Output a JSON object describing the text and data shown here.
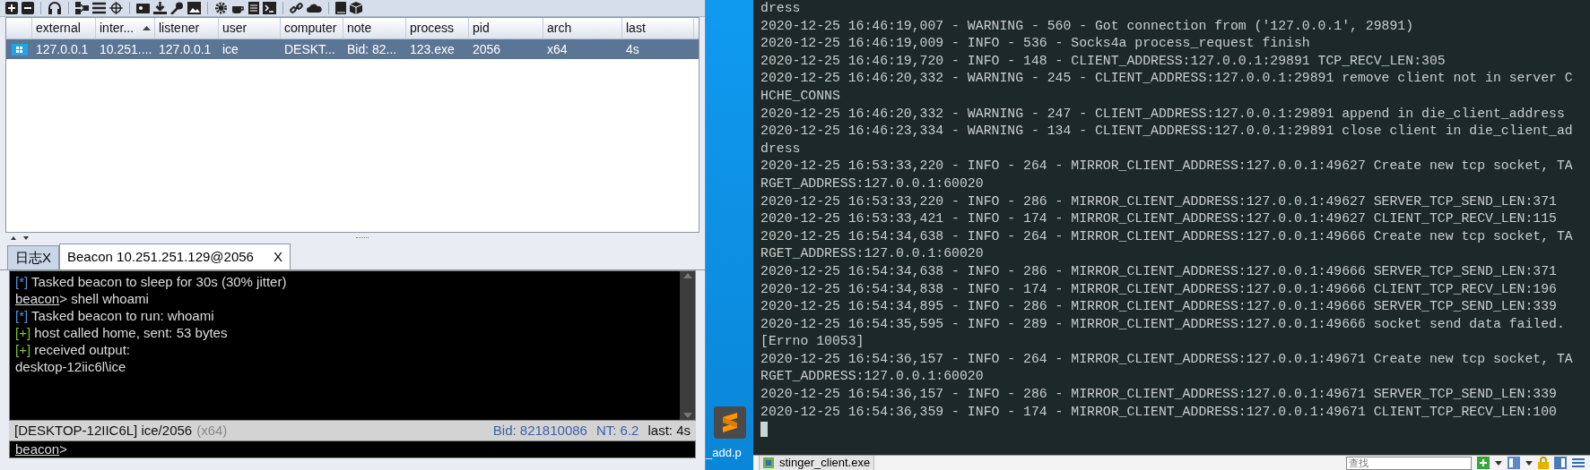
{
  "beacons_table": {
    "columns": [
      {
        "label": "external",
        "sorted": false
      },
      {
        "label": "inter...",
        "sorted": true
      },
      {
        "label": "listener",
        "sorted": false
      },
      {
        "label": "user",
        "sorted": false
      },
      {
        "label": "computer",
        "sorted": false
      },
      {
        "label": "note",
        "sorted": false
      },
      {
        "label": "process",
        "sorted": false
      },
      {
        "label": "pid",
        "sorted": false
      },
      {
        "label": "arch",
        "sorted": false
      },
      {
        "label": "last",
        "sorted": false
      }
    ],
    "rows": [
      {
        "selected": true,
        "cells": [
          "127.0.0.1",
          "10.251....",
          "127.0.0.1",
          "ice",
          "DESKT...",
          "Bid: 82...",
          "123.exe",
          "2056",
          "x64",
          "4s"
        ]
      }
    ]
  },
  "tabs": [
    {
      "label": "日志X",
      "selected": false
    },
    {
      "label": "Beacon 10.251.251.129@2056",
      "close": "X",
      "selected": true
    }
  ],
  "console": {
    "lines": [
      {
        "kind": "tag",
        "tag": "[*]",
        "color": "#5b8fd6",
        "text": "Tasked beacon to sleep for 30s (30% jitter)"
      },
      {
        "kind": "command",
        "prompt": "beacon",
        "text": "> shell whoami"
      },
      {
        "kind": "tag",
        "tag": "[*]",
        "color": "#5b8fd6",
        "text": "Tasked beacon to run: whoami"
      },
      {
        "kind": "tag",
        "tag": "[+]",
        "color": "#7cc23a",
        "text": "host called home, sent: 53 bytes"
      },
      {
        "kind": "tag",
        "tag": "[+]",
        "color": "#7cc23a",
        "text": "received output:"
      },
      {
        "kind": "output",
        "text": "desktop-12iic6l\\ice"
      }
    ]
  },
  "status_bar": {
    "host": "[DESKTOP-12IIC6L] ice/2056",
    "arch": "(x64)",
    "bid": "Bid: 821810086",
    "nt": "NT: 6.2",
    "last": "last: 4s"
  },
  "input": {
    "prompt": "beacon",
    "text": ">"
  },
  "desktop": {
    "file_label": "_add.p"
  },
  "terminal": {
    "lines": [
      "dress",
      "2020-12-25 16:46:19,007 - WARNING - 560 - Got connection from ('127.0.0.1', 29891)",
      "2020-12-25 16:46:19,009 - INFO - 536 - Socks4a process_request finish",
      "2020-12-25 16:46:19,720 - INFO - 148 - CLIENT_ADDRESS:127.0.0.1:29891 TCP_RECV_LEN:305",
      "2020-12-25 16:46:20,332 - WARNING - 245 - CLIENT_ADDRESS:127.0.0.1:29891 remove client not in server C",
      "HCHE_CONNS",
      "2020-12-25 16:46:20,332 - WARNING - 247 - CLIENT_ADDRESS:127.0.0.1:29891 append in die_client_address",
      "2020-12-25 16:46:23,334 - WARNING - 134 - CLIENT_ADDRESS:127.0.0.1:29891 close client in die_client_ad",
      "dress",
      "2020-12-25 16:53:33,220 - INFO - 264 - MIRROR_CLIENT_ADDRESS:127.0.0.1:49627 Create new tcp socket, TA",
      "RGET_ADDRESS:127.0.0.1:60020",
      "2020-12-25 16:53:33,220 - INFO - 286 - MIRROR_CLIENT_ADDRESS:127.0.0.1:49627 SERVER_TCP_SEND_LEN:371",
      "2020-12-25 16:53:33,421 - INFO - 174 - MIRROR_CLIENT_ADDRESS:127.0.0.1:49627 CLIENT_TCP_RECV_LEN:115",
      "2020-12-25 16:54:34,638 - INFO - 264 - MIRROR_CLIENT_ADDRESS:127.0.0.1:49666 Create new tcp socket, TA",
      "RGET_ADDRESS:127.0.0.1:60020",
      "2020-12-25 16:54:34,638 - INFO - 286 - MIRROR_CLIENT_ADDRESS:127.0.0.1:49666 SERVER_TCP_SEND_LEN:371",
      "2020-12-25 16:54:34,838 - INFO - 174 - MIRROR_CLIENT_ADDRESS:127.0.0.1:49666 CLIENT_TCP_RECV_LEN:196",
      "2020-12-25 16:54:34,895 - INFO - 286 - MIRROR_CLIENT_ADDRESS:127.0.0.1:49666 SERVER_TCP_SEND_LEN:339",
      "2020-12-25 16:54:35,595 - INFO - 289 - MIRROR_CLIENT_ADDRESS:127.0.0.1:49666 socket send data failed.",
      "[Errno 10053]",
      "2020-12-25 16:54:36,157 - INFO - 264 - MIRROR_CLIENT_ADDRESS:127.0.0.1:49671 Create new tcp socket, TA",
      "RGET_ADDRESS:127.0.0.1:60020",
      "2020-12-25 16:54:36,157 - INFO - 286 - MIRROR_CLIENT_ADDRESS:127.0.0.1:49671 SERVER_TCP_SEND_LEN:339",
      "2020-12-25 16:54:36,359 - INFO - 174 - MIRROR_CLIENT_ADDRESS:127.0.0.1:49671 CLIENT_TCP_RECV_LEN:100"
    ]
  },
  "taskbar": {
    "window": "stinger_client.exe",
    "search_placeholder": "查找"
  }
}
